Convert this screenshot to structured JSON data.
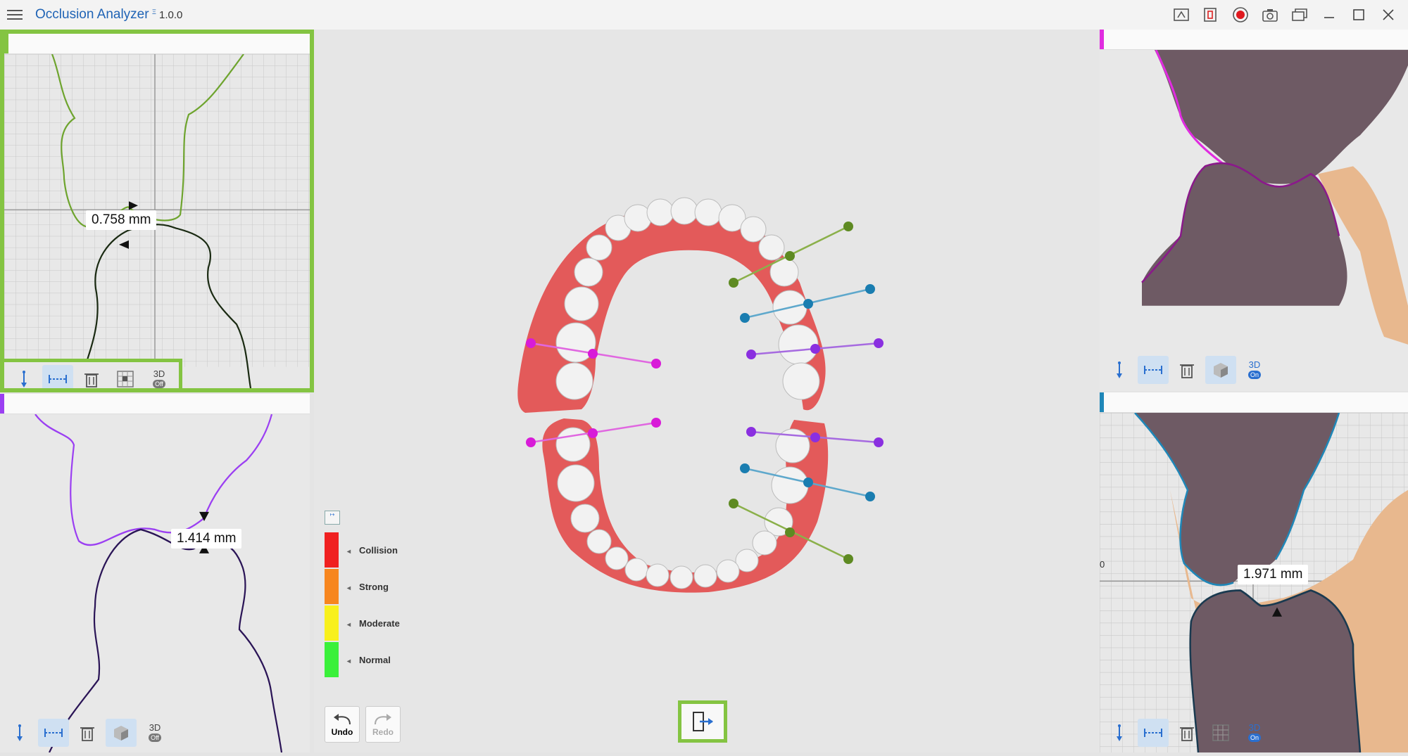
{
  "app": {
    "title": "Occlusion Analyzer",
    "version": "1.0.0"
  },
  "titlebar": {
    "icons": [
      "measure-view-icon",
      "screen-capture-icon",
      "record-icon",
      "camera-icon",
      "windows-icon",
      "minimize-icon",
      "maximize-icon",
      "close-icon"
    ]
  },
  "panels": {
    "top_left": {
      "measurement": "0.758 mm",
      "axis_zero": "0",
      "accent": "#84c442",
      "toggle_3d": {
        "label": "3D",
        "state": "Off"
      }
    },
    "bottom_left": {
      "measurement": "1.414 mm",
      "accent": "#9b3ff2",
      "toggle_3d": {
        "label": "3D",
        "state": "Off"
      }
    },
    "top_right": {
      "accent": "#e02ce0",
      "toggle_3d": {
        "label": "3D",
        "state": "On"
      }
    },
    "bottom_right": {
      "measurement": "1.971 mm",
      "axis_zero": "0",
      "accent": "#1f87b8",
      "toggle_3d": {
        "label": "3D",
        "state": "On"
      }
    }
  },
  "legend": {
    "items": [
      {
        "label": "Collision",
        "color": "#f02020"
      },
      {
        "label": "Strong",
        "color": "#f7861e"
      },
      {
        "label": "Moderate",
        "color": "#f8f01c"
      },
      {
        "label": "Normal",
        "color": "#3af03a"
      }
    ]
  },
  "history": {
    "undo": "Undo",
    "redo": "Redo"
  },
  "colors": {
    "highlight": "#84c442",
    "gum": "#e35a5a",
    "tooth": "#f2f2f2"
  }
}
